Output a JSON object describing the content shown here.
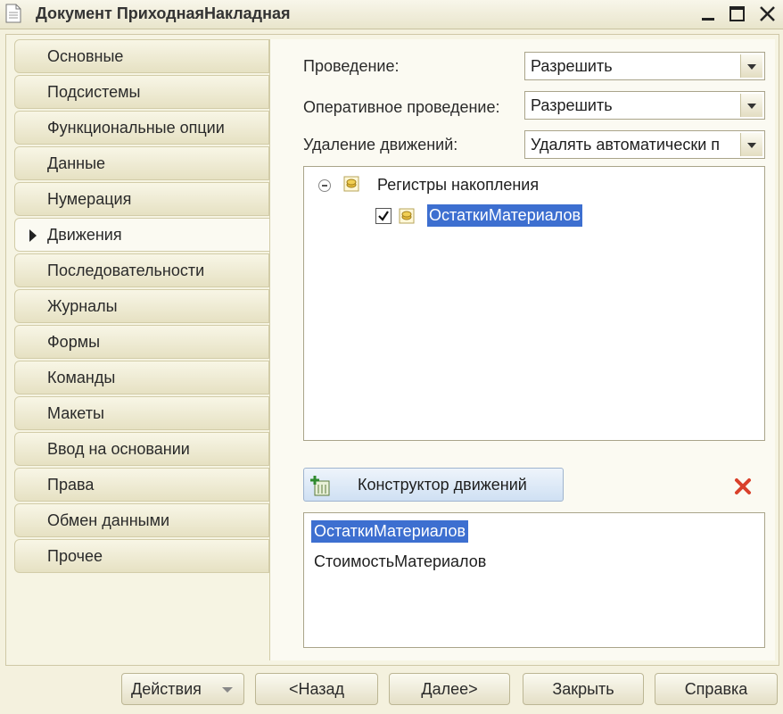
{
  "window": {
    "title": "Документ ПриходнаяНакладная"
  },
  "nav": {
    "items": [
      {
        "label": "Основные"
      },
      {
        "label": "Подсистемы"
      },
      {
        "label": "Функциональные опции"
      },
      {
        "label": "Данные"
      },
      {
        "label": "Нумерация"
      },
      {
        "label": "Движения",
        "active": true
      },
      {
        "label": "Последовательности"
      },
      {
        "label": "Журналы"
      },
      {
        "label": "Формы"
      },
      {
        "label": "Команды"
      },
      {
        "label": "Макеты"
      },
      {
        "label": "Ввод на основании"
      },
      {
        "label": "Права"
      },
      {
        "label": "Обмен данными"
      },
      {
        "label": "Прочее"
      }
    ]
  },
  "form": {
    "posting": {
      "label": "Проведение:",
      "value": "Разрешить"
    },
    "realtime_posting": {
      "label": "Оперативное проведение:",
      "value": "Разрешить"
    },
    "delete_movements": {
      "label": "Удаление движений:",
      "value": "Удалять автоматически п"
    }
  },
  "tree": {
    "group_label": "Регистры накопления",
    "item_label": "ОстаткиМатериалов",
    "item_checked": true
  },
  "constructor_button": {
    "label": "Конструктор движений"
  },
  "list": {
    "items": [
      {
        "label": "ОстаткиМатериалов",
        "selected": true
      },
      {
        "label": "СтоимостьМатериалов",
        "selected": false
      }
    ]
  },
  "footer": {
    "actions_label": "Действия",
    "back_label": "<Назад",
    "next_label": "Далее>",
    "close_label": "Закрыть",
    "help_label": "Справка"
  },
  "colors": {
    "selection": "#3d6fd0",
    "delete_icon": "#d9402b"
  }
}
